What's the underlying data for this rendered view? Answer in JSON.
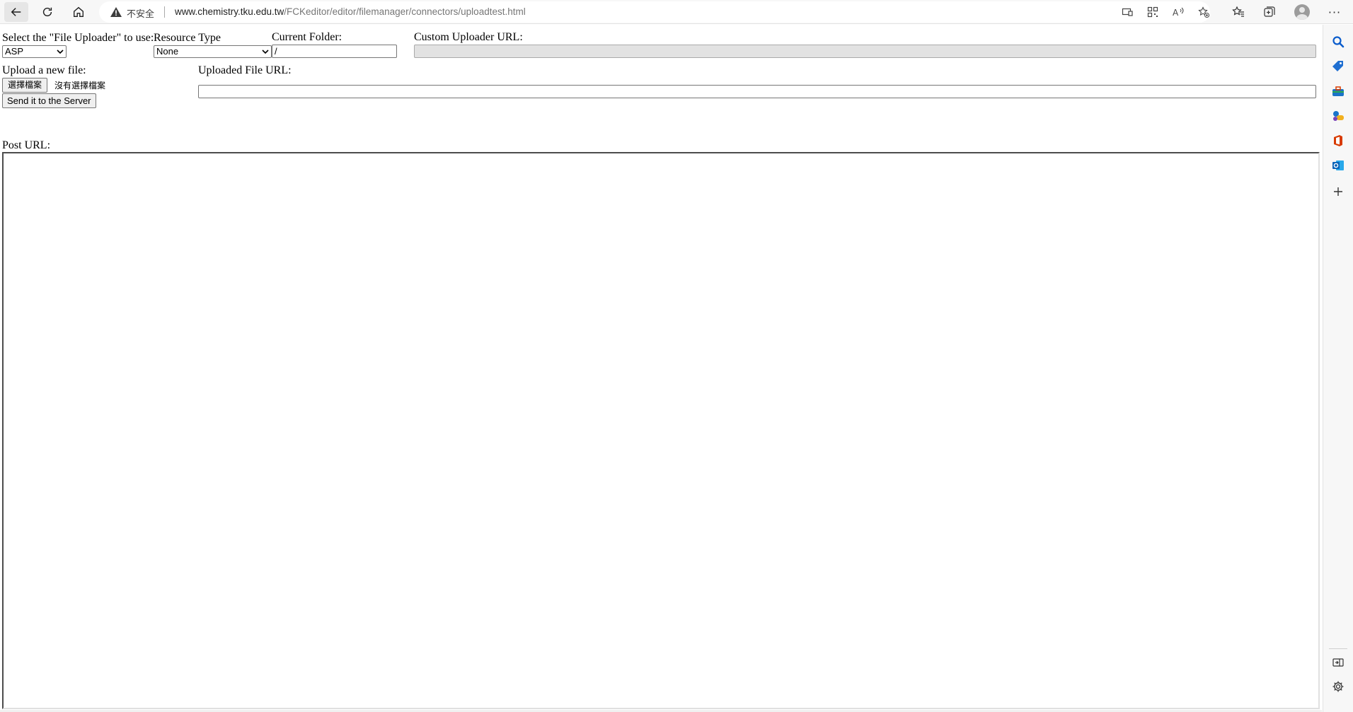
{
  "browser": {
    "insecure_label": "不安全",
    "url_host": "www.chemistry.tku.edu.tw",
    "url_path": "/FCKeditor/editor/filemanager/connectors/uploadtest.html",
    "more_label": "···"
  },
  "form": {
    "uploader_label": "Select the \"File Uploader\" to use:",
    "uploader_value": "ASP",
    "resource_type_label": "Resource Type",
    "resource_type_value": "None",
    "current_folder_label": "Current Folder:",
    "current_folder_value": "/",
    "custom_url_label": "Custom Uploader URL:",
    "custom_url_value": "",
    "upload_label": "Upload a new file:",
    "choose_file_button": "選擇檔案",
    "no_file_text": "沒有選擇檔案",
    "send_button": "Send it to the Server",
    "uploaded_url_label": "Uploaded File URL:",
    "uploaded_url_value": "",
    "post_url_label": "Post URL:"
  },
  "icons": {
    "back": "arrow-left-icon",
    "refresh": "refresh-icon",
    "home": "home-icon",
    "warning": "warning-triangle-icon",
    "sidebar": [
      "search-icon",
      "tag-icon",
      "briefcase-icon",
      "games-icon",
      "office-icon",
      "outlook-icon",
      "plus-icon",
      "sidebar-toggle-icon",
      "gear-icon"
    ]
  },
  "colors": {
    "chrome_bg": "#f7f7f7",
    "search_blue": "#0a5ccc",
    "office_red": "#d83b01",
    "outlook_blue": "#0a64b8"
  }
}
